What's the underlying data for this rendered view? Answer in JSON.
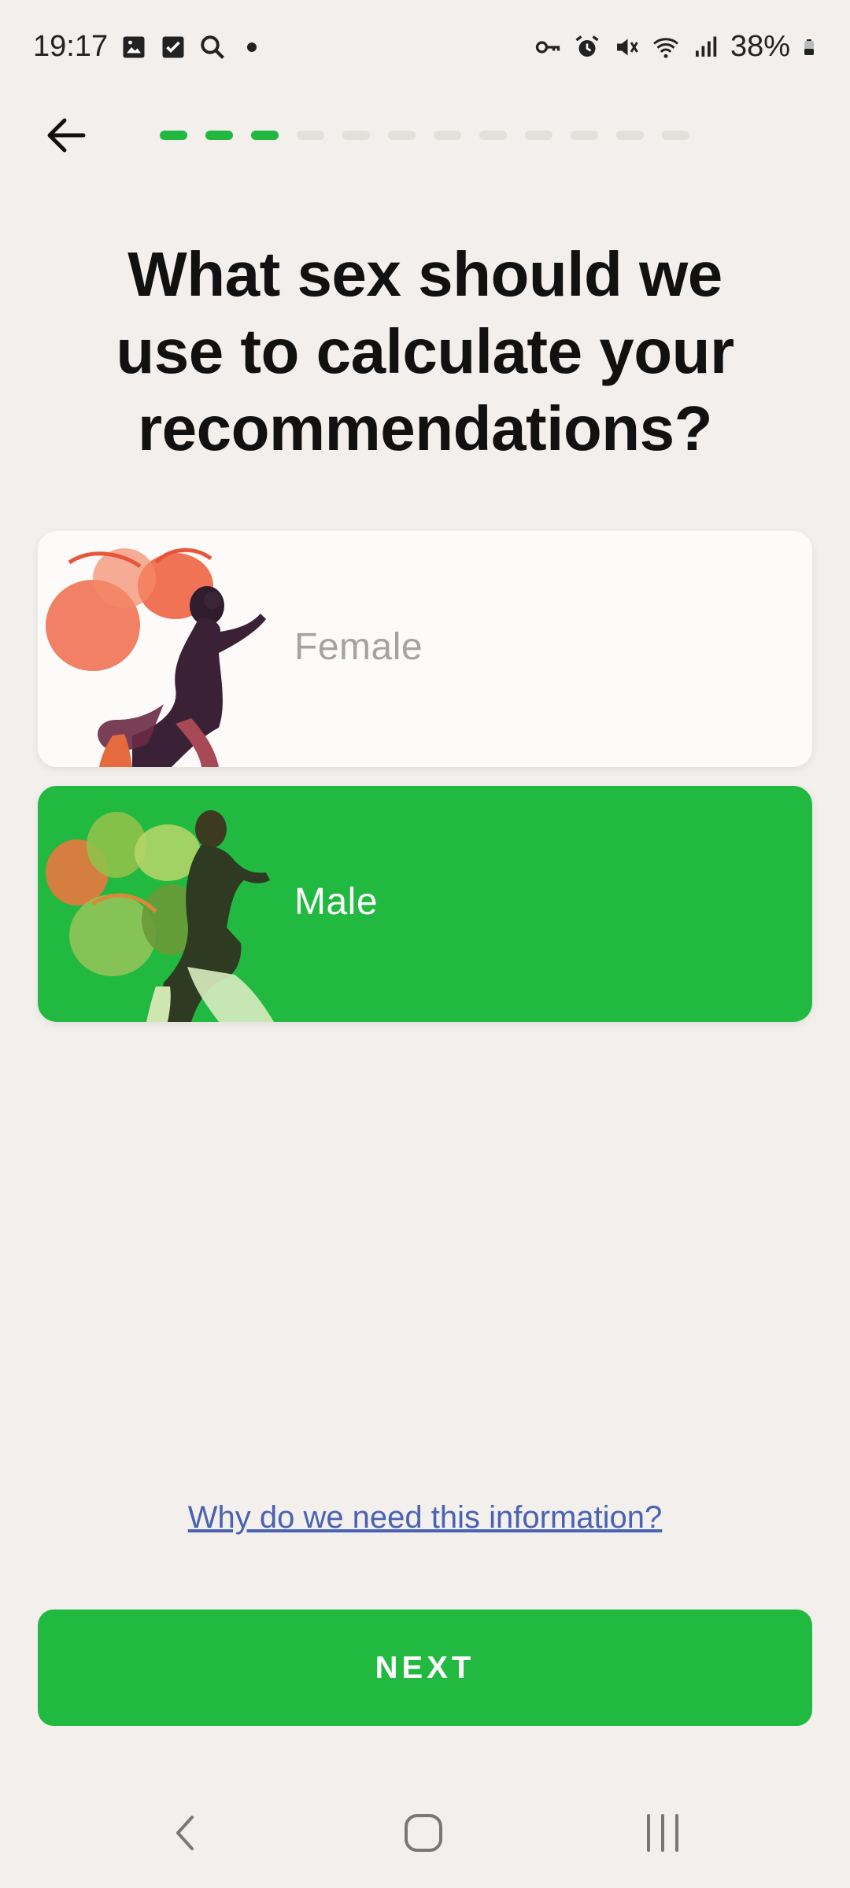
{
  "status_bar": {
    "time": "19:17",
    "battery": "38%",
    "left_icons": [
      "gallery-icon",
      "checkbox-icon",
      "search-icon",
      "dot-icon"
    ],
    "right_icons": [
      "vpn-key-icon",
      "alarm-icon",
      "mute-icon",
      "wifi-icon",
      "signal-icon",
      "battery-icon"
    ]
  },
  "header": {
    "progress_total": 12,
    "progress_done": 3,
    "accent_color": "#22b740"
  },
  "question": {
    "title": "What sex should we use to calculate your recommendations?"
  },
  "options": [
    {
      "label": "Female",
      "selected": false
    },
    {
      "label": "Male",
      "selected": true
    }
  ],
  "info_link": "Why do we need this information?",
  "next_button": "NEXT",
  "system_nav": [
    "back-nav-icon",
    "home-nav-icon",
    "recents-nav-icon"
  ]
}
